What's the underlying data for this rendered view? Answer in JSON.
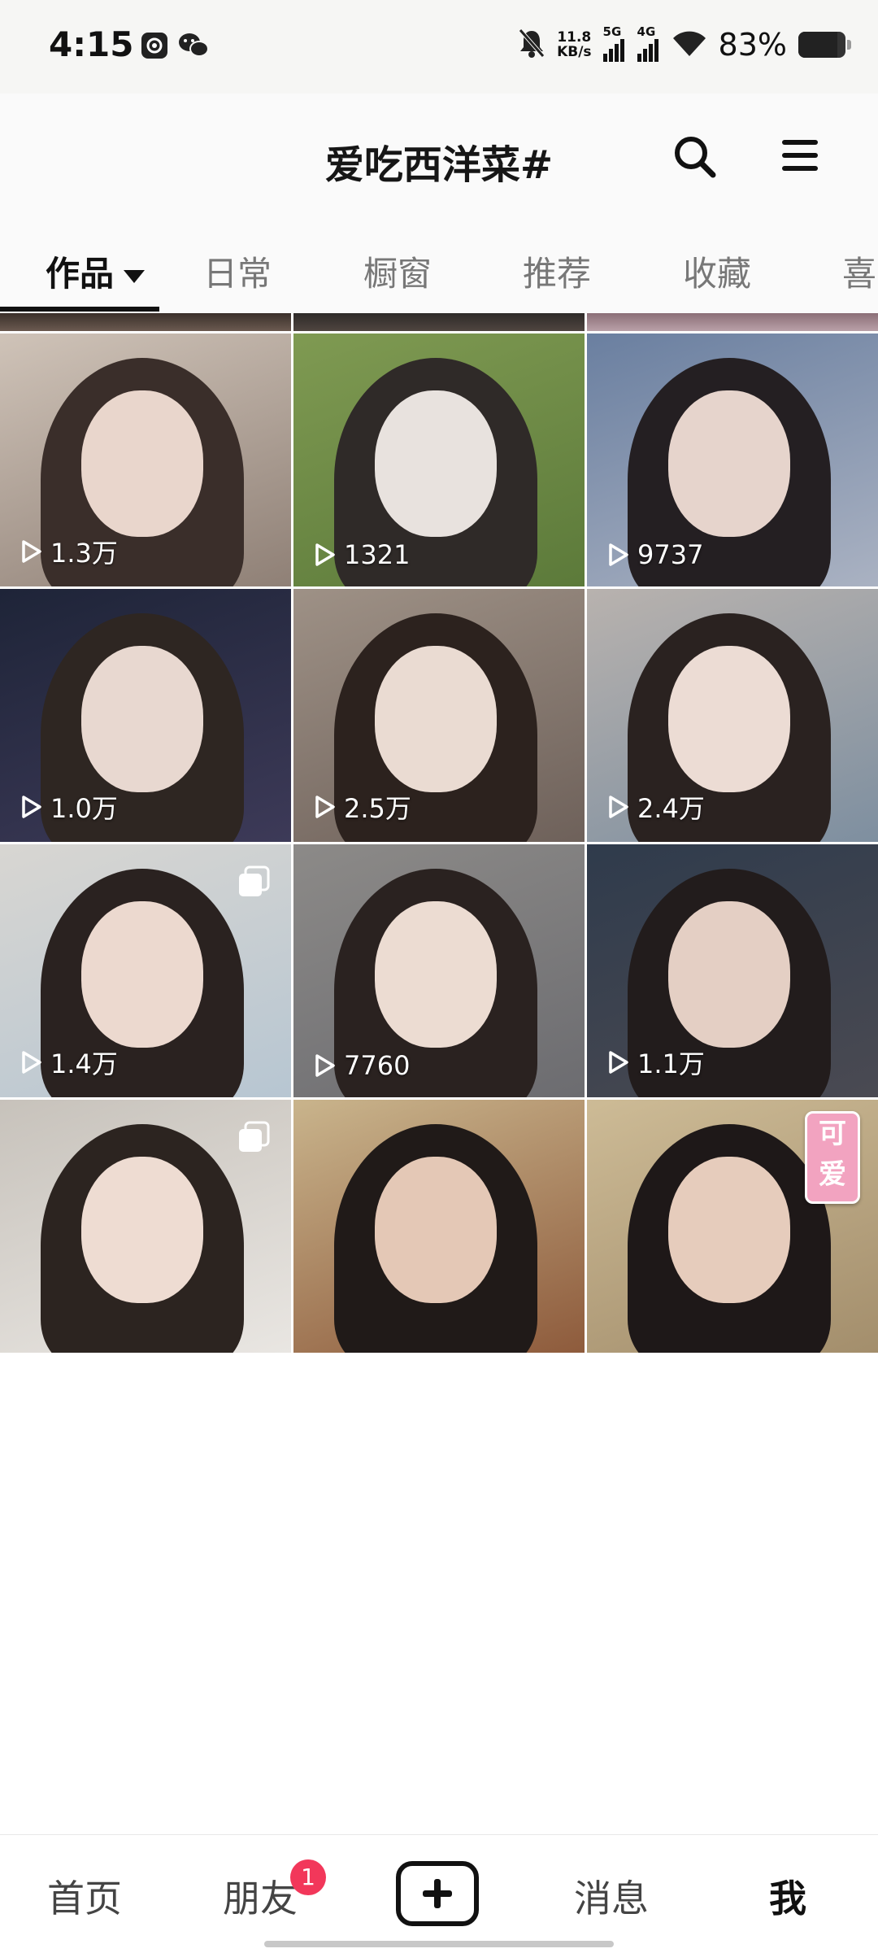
{
  "status_bar": {
    "time": "4:15",
    "net_speed_value": "11.8",
    "net_speed_unit": "KB/s",
    "network_1": "5G",
    "network_2": "4G",
    "battery_percent": "83%",
    "battery_level": 0.83
  },
  "header": {
    "profile_name": "爱吃西洋菜#",
    "icons": [
      "search-icon",
      "menu-icon"
    ]
  },
  "tabs": [
    {
      "label": "作品",
      "active": true
    },
    {
      "label": "日常",
      "active": false
    },
    {
      "label": "橱窗",
      "active": false
    },
    {
      "label": "推荐",
      "active": false
    },
    {
      "label": "收藏",
      "active": false
    },
    {
      "label": "喜",
      "active": false
    }
  ],
  "videos": [
    {
      "views": "1.3万",
      "multi": false
    },
    {
      "views": "1321",
      "multi": false
    },
    {
      "views": "9737",
      "multi": false
    },
    {
      "views": "1.0万",
      "multi": false
    },
    {
      "views": "2.5万",
      "multi": false
    },
    {
      "views": "2.4万",
      "multi": false
    },
    {
      "views": "1.4万",
      "multi": true
    },
    {
      "views": "7760",
      "multi": false
    },
    {
      "views": "1.1万",
      "multi": false
    },
    {
      "views": "",
      "multi": true
    },
    {
      "views": "",
      "multi": false
    },
    {
      "views": "",
      "multi": true,
      "sticker": "可爱"
    }
  ],
  "bottom_nav": {
    "home": "首页",
    "friends": "朋友",
    "friends_badge": "1",
    "messages": "消息",
    "me": "我"
  },
  "colors": {
    "badge": "#f2375a",
    "status_bar_bg": "#f6f6f4",
    "text_primary": "#111111",
    "text_secondary": "#777777"
  }
}
